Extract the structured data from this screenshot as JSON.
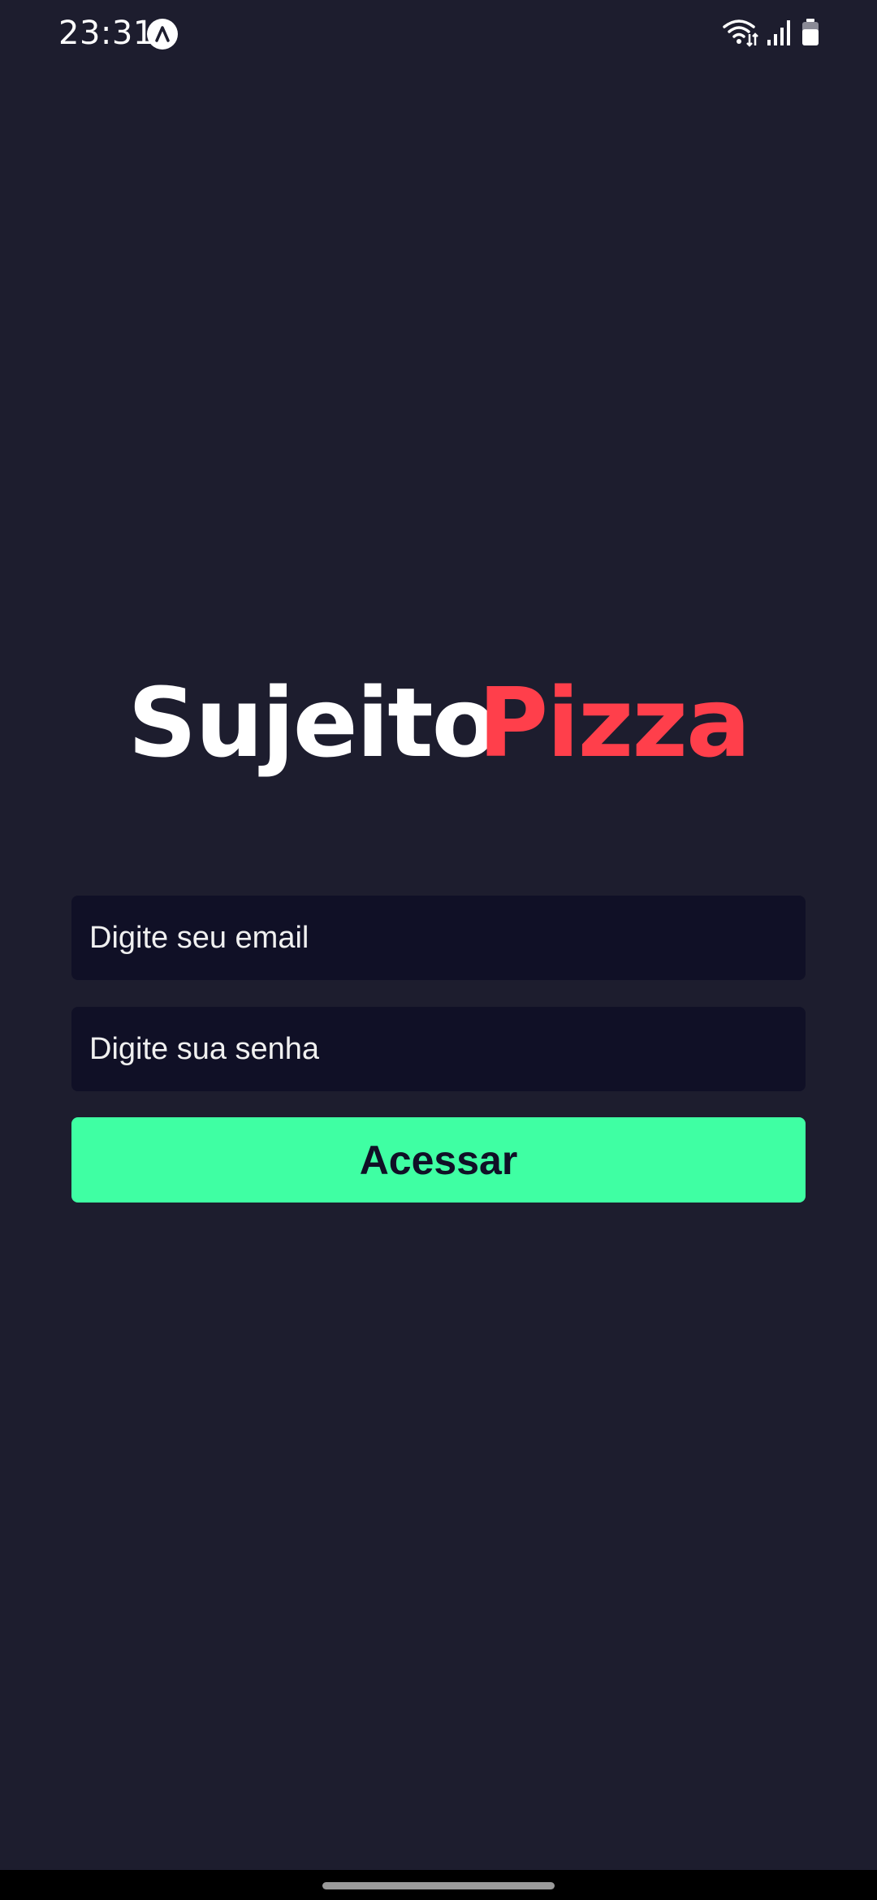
{
  "status_bar": {
    "time": "23:31",
    "app_indicator_icon": "expo-icon",
    "icons": [
      "wifi-icon",
      "signal-icon",
      "battery-icon"
    ]
  },
  "logo": {
    "part1": "Sujeito",
    "part2": "Pizza",
    "colors": {
      "part1": "#ffffff",
      "part2": "#ff3f4b"
    }
  },
  "form": {
    "email_placeholder": "Digite seu email",
    "password_placeholder": "Digite sua senha",
    "submit_label": "Acessar"
  },
  "colors": {
    "background": "#1d1d2e",
    "input_background": "#101026",
    "accent": "#3fffa3"
  }
}
